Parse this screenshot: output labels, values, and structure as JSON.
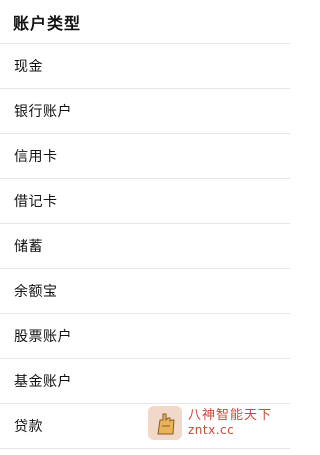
{
  "header": {
    "title": "账户类型"
  },
  "account_types": [
    {
      "label": "现金"
    },
    {
      "label": "银行账户"
    },
    {
      "label": "信用卡"
    },
    {
      "label": "借记卡"
    },
    {
      "label": "储蓄"
    },
    {
      "label": "余额宝"
    },
    {
      "label": "股票账户"
    },
    {
      "label": "基金账户"
    },
    {
      "label": "贷款"
    }
  ],
  "watermark": {
    "title": "八神智能天下",
    "subtitle": "zntx.cc",
    "icon": "hand-logo-icon"
  },
  "colors": {
    "divider": "#e6e6e6",
    "text": "#111111",
    "watermark": "#c84a3a"
  }
}
